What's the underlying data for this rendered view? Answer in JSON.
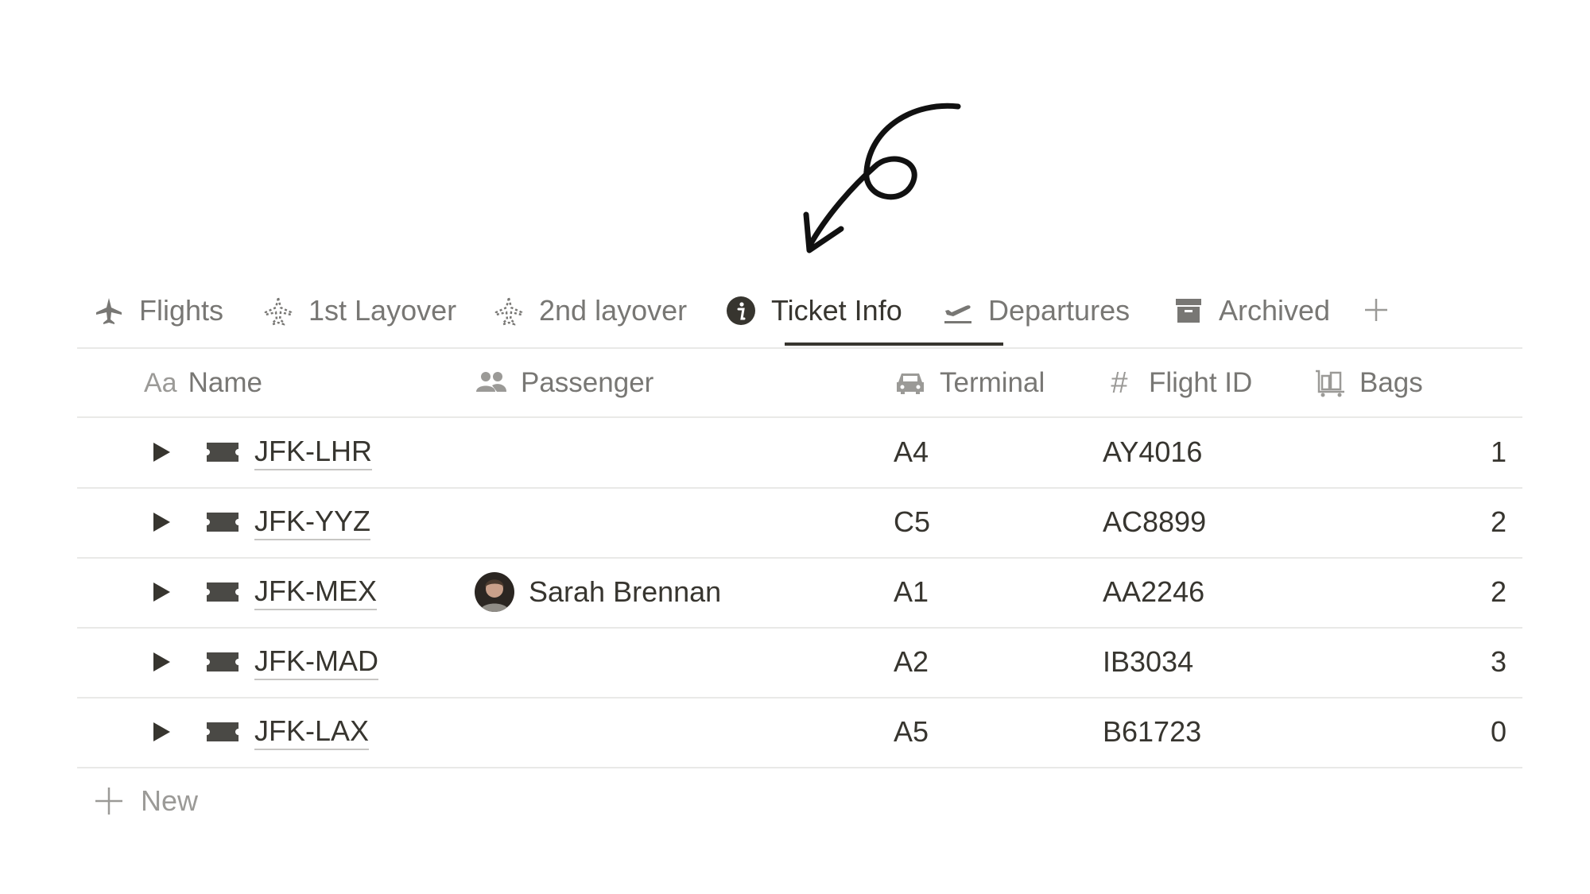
{
  "tabs": [
    {
      "label": "Flights",
      "icon": "airplane-icon"
    },
    {
      "label": "1st Layover",
      "icon": "airplane-dashed-icon"
    },
    {
      "label": "2nd layover",
      "icon": "airplane-dashed-icon"
    },
    {
      "label": "Ticket Info",
      "icon": "info-icon",
      "active": true
    },
    {
      "label": "Departures",
      "icon": "departure-icon"
    },
    {
      "label": "Archived",
      "icon": "archive-box-icon"
    }
  ],
  "columns": {
    "name": {
      "label": "Name",
      "icon_text": "Aa"
    },
    "passenger": {
      "label": "Passenger",
      "icon": "people-icon"
    },
    "terminal": {
      "label": "Terminal",
      "icon": "car-icon"
    },
    "flight_id": {
      "label": "Flight ID",
      "icon_text": "#"
    },
    "bags": {
      "label": "Bags",
      "icon": "luggage-cart-icon"
    }
  },
  "rows": [
    {
      "name": "JFK-LHR",
      "passenger": "",
      "terminal": "A4",
      "flight_id": "AY4016",
      "bags": "1"
    },
    {
      "name": "JFK-YYZ",
      "passenger": "",
      "terminal": "C5",
      "flight_id": "AC8899",
      "bags": "2"
    },
    {
      "name": "JFK-MEX",
      "passenger": "Sarah Brennan",
      "terminal": "A1",
      "flight_id": "AA2246",
      "bags": "2"
    },
    {
      "name": "JFK-MAD",
      "passenger": "",
      "terminal": "A2",
      "flight_id": "IB3034",
      "bags": "3"
    },
    {
      "name": "JFK-LAX",
      "passenger": "",
      "terminal": "A5",
      "flight_id": "B61723",
      "bags": "0"
    }
  ],
  "new_label": "New",
  "colors": {
    "text": "#37352f",
    "muted": "#787774",
    "divider": "#e9e9e7"
  }
}
